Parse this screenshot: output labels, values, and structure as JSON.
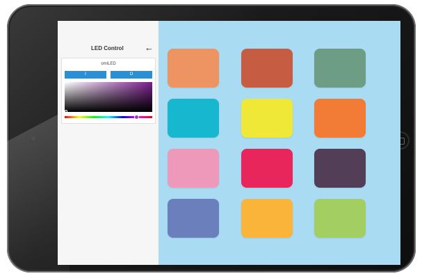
{
  "header": {
    "title": "LED Control",
    "back_icon": "arrow-left-icon"
  },
  "device": {
    "name": "omiLED",
    "on_label": "I",
    "off_label": "O",
    "hue_position": 0.82
  },
  "swatches": [
    {
      "color": "#EE9463"
    },
    {
      "color": "#C65D43"
    },
    {
      "color": "#6E9D86"
    },
    {
      "color": "#17B8CF"
    },
    {
      "color": "#EFE837"
    },
    {
      "color": "#F27B35"
    },
    {
      "color": "#EE98BA"
    },
    {
      "color": "#E8265B"
    },
    {
      "color": "#523F57"
    },
    {
      "color": "#6B7FBD"
    },
    {
      "color": "#FBB43A"
    },
    {
      "color": "#A3CE62"
    }
  ]
}
